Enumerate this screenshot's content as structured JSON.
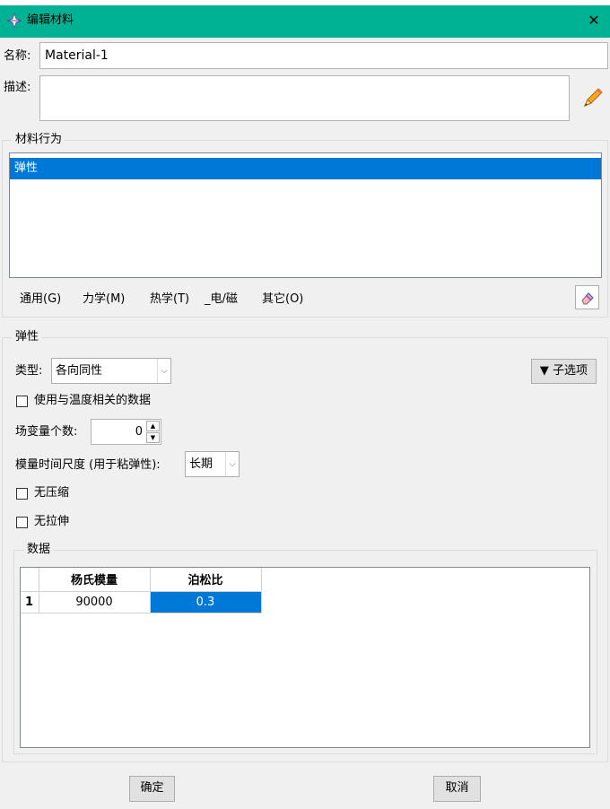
{
  "window": {
    "title": "编辑材料",
    "close_glyph": "✕"
  },
  "colors": {
    "titlebar": "#00b294",
    "selection": "#0078d7",
    "dialog_bg": "#f0f0f0"
  },
  "name_field": {
    "label": "名称:",
    "value": "Material-1"
  },
  "description_field": {
    "label": "描述:",
    "value": "",
    "edit_icon": "pencil-icon"
  },
  "material_behaviors": {
    "group_title": "材料行为",
    "items": [
      "弹性"
    ],
    "selected_index": 0
  },
  "behavior_menu": {
    "items": [
      "通用(G)",
      "力学(M)",
      "热学(T)",
      "_电/磁",
      "其它(O)"
    ],
    "eraser_icon": "eraser-icon"
  },
  "elastic": {
    "group_title": "弹性",
    "type_label": "类型:",
    "type_value": "各向同性",
    "suboptions_label": "▼ 子选项",
    "temp_dependent_label": "使用与温度相关的数据",
    "temp_dependent_checked": false,
    "field_vars_label": "场变量个数:",
    "field_vars_value": "0",
    "timescale_label": "模量时间尺度 (用于粘弹性):",
    "timescale_value": "长期",
    "no_compression_label": "无压缩",
    "no_compression_checked": false,
    "no_tension_label": "无拉伸",
    "no_tension_checked": false
  },
  "data_table": {
    "group_title": "数据",
    "columns": [
      "杨氏模量",
      "泊松比"
    ],
    "rows": [
      {
        "index": "1",
        "cells": [
          "90000",
          "0.3"
        ]
      }
    ]
  },
  "footer": {
    "ok_label": "确定",
    "cancel_label": "取消"
  }
}
